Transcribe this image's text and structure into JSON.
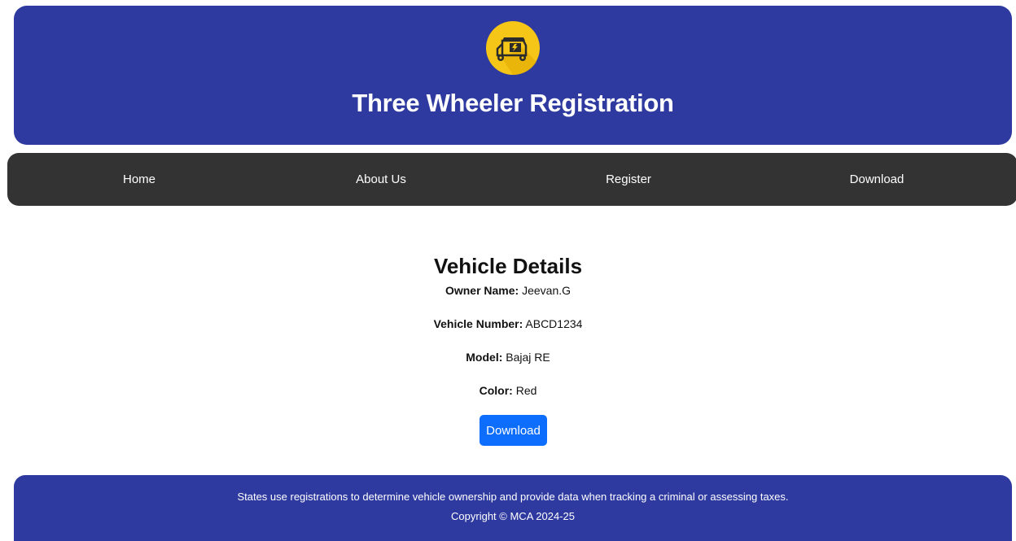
{
  "header": {
    "title": "Three Wheeler Registration",
    "logo_icon": "auto-rickshaw-icon",
    "background": "#2e3a9f",
    "logo_color": "#f5c518"
  },
  "nav": {
    "background": "#333333",
    "items": [
      {
        "label": "Home"
      },
      {
        "label": "About Us"
      },
      {
        "label": "Register"
      },
      {
        "label": "Download"
      }
    ]
  },
  "details": {
    "heading": "Vehicle Details",
    "owner_label": "Owner Name:",
    "owner_value": "Jeevan.G",
    "number_label": "Vehicle Number:",
    "number_value": "ABCD1234",
    "model_label": "Model:",
    "model_value": "Bajaj RE",
    "color_label": "Color:",
    "color_value": "Red",
    "download_label": "Download",
    "button_color": "#0d6efd"
  },
  "footer": {
    "line1": "States use registrations to determine vehicle ownership and provide data when tracking a criminal or assessing taxes.",
    "line2": "Copyright © MCA 2024-25"
  }
}
